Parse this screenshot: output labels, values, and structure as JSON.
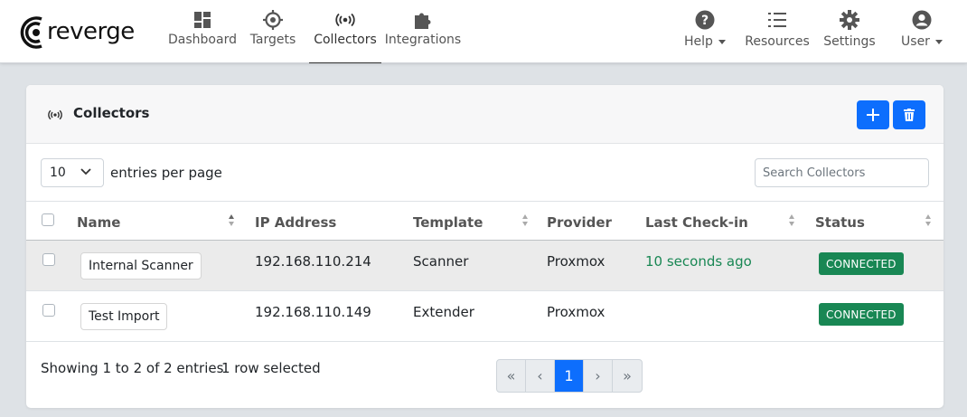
{
  "brand": {
    "logo_text": "reverge"
  },
  "nav": {
    "items": [
      {
        "label": "Dashboard",
        "icon": "dashboard-icon"
      },
      {
        "label": "Targets",
        "icon": "crosshair-icon"
      },
      {
        "label": "Collectors",
        "icon": "broadcast-icon",
        "active": true
      },
      {
        "label": "Integrations",
        "icon": "puzzle-icon"
      }
    ],
    "right": [
      {
        "label": "Help",
        "icon": "question-circle-icon",
        "dropdown": true
      },
      {
        "label": "Resources",
        "icon": "list-icon"
      },
      {
        "label": "Settings",
        "icon": "gear-icon"
      },
      {
        "label": "User",
        "icon": "user-circle-icon",
        "dropdown": true
      }
    ]
  },
  "card": {
    "title": "Collectors",
    "add_icon": "plus-icon",
    "delete_icon": "trash-icon"
  },
  "toolbar": {
    "page_size": "10",
    "entries_label": "entries per page",
    "search_placeholder": "Search Collectors"
  },
  "table": {
    "columns": [
      "Name",
      "IP Address",
      "Template",
      "Provider",
      "Last Check-in",
      "Status"
    ],
    "rows": [
      {
        "name": "Internal Scanner",
        "ip": "192.168.110.214",
        "template": "Scanner",
        "provider": "Proxmox",
        "last_checkin": "10 seconds ago",
        "status": "CONNECTED",
        "selected": true
      },
      {
        "name": "Test Import",
        "ip": "192.168.110.149",
        "template": "Extender",
        "provider": "Proxmox",
        "last_checkin": "",
        "status": "CONNECTED",
        "selected": false
      }
    ]
  },
  "footer": {
    "info": "Showing 1 to 2 of 2 entries",
    "selection": "1 row selected",
    "pager": [
      "«",
      "‹",
      "1",
      "›",
      "»"
    ],
    "current_page": "1"
  },
  "colors": {
    "primary": "#0d6efd",
    "success": "#198754"
  }
}
